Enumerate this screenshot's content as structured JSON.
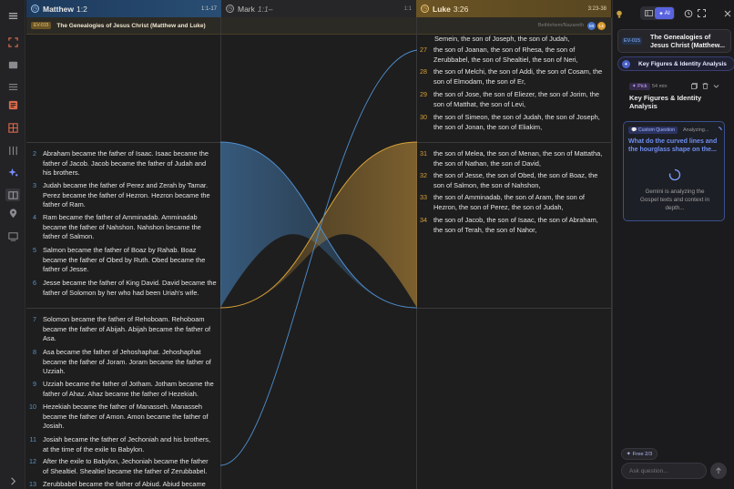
{
  "matthew": {
    "title": "Matthew",
    "ref": "1:2",
    "range": "1:1-17"
  },
  "mark": {
    "title": "Mark",
    "ref": "1:1–",
    "range": "1:1"
  },
  "luke": {
    "title": "Luke",
    "ref": "3:26",
    "range": "3:23-38"
  },
  "passage": {
    "code": "EV-015",
    "title": "The Genealogies of Jesus Christ (Matthew and Luke)",
    "location": "Bethlehem/Nazareth",
    "badge_mt": "Mt",
    "badge_lk": "Lk"
  },
  "matthew_verses": [
    {
      "n": "2",
      "lines": [
        "Abraham became the father of Isaac. Isaac became the",
        "father of Jacob. Jacob became the father of Judah and",
        "his brothers."
      ]
    },
    {
      "n": "3",
      "lines": [
        "Judah became the father of Perez and Zerah by Tamar.",
        "Perez became the father of Hezron. Hezron became the",
        "father of Ram."
      ]
    },
    {
      "n": "4",
      "lines": [
        "Ram became the father of Amminadab. Amminadab",
        "became the father of Nahshon. Nahshon became the",
        "father of Salmon."
      ]
    },
    {
      "n": "5",
      "lines": [
        "Salmon became the father of Boaz by Rahab. Boaz",
        "became the father of Obed by Ruth. Obed became the",
        "father of Jesse."
      ]
    },
    {
      "n": "6",
      "lines": [
        "Jesse became the father of King David. David became the",
        "father of Solomon by her who had been Uriah's wife."
      ]
    },
    {
      "n": "7",
      "lines": [
        "Solomon became the father of Rehoboam. Rehoboam",
        "became the father of Abijah. Abijah became the father of",
        "Asa."
      ]
    },
    {
      "n": "8",
      "lines": [
        "Asa became the father of Jehoshaphat. Jehoshaphat",
        "became the father of Joram. Joram became the father of",
        "Uzziah."
      ]
    },
    {
      "n": "9",
      "lines": [
        "Uzziah became the father of Jotham. Jotham became the",
        "father of Ahaz. Ahaz became the father of Hezekiah."
      ]
    },
    {
      "n": "10",
      "lines": [
        "Hezekiah became the father of Manasseh. Manasseh",
        "became the father of Amon. Amon became the father of",
        "Josiah."
      ]
    },
    {
      "n": "11",
      "lines": [
        "Josiah became the father of Jechoniah and his brothers,",
        "at the time of the exile to Babylon."
      ]
    },
    {
      "n": "12",
      "lines": [
        "After the exile to Babylon, Jechoniah became the father",
        "of Shealtiel. Shealtiel became the father of Zerubbabel."
      ]
    },
    {
      "n": "13",
      "lines": [
        "Zerubbabel became the father of Abiud. Abiud became"
      ]
    }
  ],
  "luke_top_line": "Semein, the son of Joseph, the son of Judah,",
  "luke_verses": [
    {
      "n": "27",
      "lines": [
        "the son of Joanan, the son of Rhesa, the son of",
        "Zerubbabel, the son of Shealtiel, the son of Neri,"
      ]
    },
    {
      "n": "28",
      "lines": [
        "the son of Melchi, the son of Addi, the son of Cosam, the",
        "son of Elmodam, the son of Er,"
      ]
    },
    {
      "n": "29",
      "lines": [
        "the son of Jose, the son of Eliezer, the son of Jorim, the",
        "son of Matthat, the son of Levi,"
      ]
    },
    {
      "n": "30",
      "lines": [
        "the son of Simeon, the son of Judah, the son of Joseph,",
        "the son of Jonan, the son of Eliakim,"
      ]
    },
    {
      "n": "31",
      "lines": [
        "the son of Melea, the son of Menan, the son of Mattatha,",
        "the son of Nathan, the son of David,"
      ]
    },
    {
      "n": "32",
      "lines": [
        "the son of Jesse, the son of Obed, the son of Boaz, the",
        "son of Salmon, the son of Nahshon,"
      ]
    },
    {
      "n": "33",
      "lines": [
        "the son of Amminadab, the son of Aram, the son of",
        "Hezron, the son of Perez, the son of Judah,"
      ]
    },
    {
      "n": "34",
      "lines": [
        "the son of Jacob, the son of Isaac, the son of Abraham,",
        "the son of Terah, the son of Nahor,"
      ]
    }
  ],
  "panel": {
    "ai_label": "AI",
    "event_code": "EV-015",
    "event_title_1": "The Genealogies of",
    "event_title_2": "Jesus Christ (Matthew...",
    "active_tab": "Key Figures & Identity Analysis",
    "pick_label": "Pick",
    "duration": "54 min",
    "card_title_1": "Key Figures & Identity",
    "card_title_2": "Analysis",
    "q_tag": "Custom Question",
    "q_status": "Analyzing...",
    "q_text_1": "What do the curved lines and",
    "q_text_2": "the hourglass shape on the...",
    "loading_1": "Gemini is analyzing the",
    "loading_2": "Gospel texts and context in",
    "loading_3": "depth...",
    "free_label": "Free 2/3",
    "ask_placeholder": "Ask question..."
  },
  "colors": {
    "matthew": "#5a93c8",
    "luke": "#d7a037",
    "accent": "#6b7cff"
  }
}
